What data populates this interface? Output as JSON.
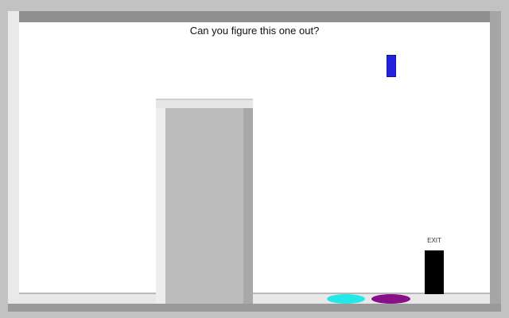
{
  "game": {
    "message": "Can you figure this one out?",
    "exit_label": "EXIT"
  },
  "colors": {
    "player": "#2222dd",
    "exit_door": "#000000",
    "pad_cyan": "#22e8e8",
    "pad_purple": "#880f88",
    "wall": "#c2c2c2",
    "room": "#ffffff"
  },
  "icons": {
    "player": "blue-block",
    "exit": "black-door",
    "pads": [
      "cyan-portal",
      "purple-portal"
    ]
  }
}
